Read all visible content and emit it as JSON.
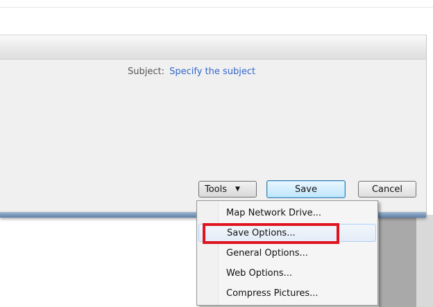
{
  "dialog": {
    "subject_label": "Subject:",
    "subject_value": "Specify the subject"
  },
  "buttons": {
    "tools_label": "Tools",
    "save_label": "Save",
    "cancel_label": "Cancel"
  },
  "tools_menu": {
    "items": [
      {
        "label": "Map Network Drive..."
      },
      {
        "label": "Save Options..."
      },
      {
        "label": "General Options..."
      },
      {
        "label": "Web Options..."
      },
      {
        "label": "Compress Pictures..."
      }
    ],
    "highlighted_item": "Save Options..."
  },
  "colors": {
    "subject_value": "#3366cc",
    "annotation_box": "#e0141e",
    "save_button_border": "#3c7fb1"
  },
  "icons": {
    "tools_caret": "chevron-down-icon"
  }
}
